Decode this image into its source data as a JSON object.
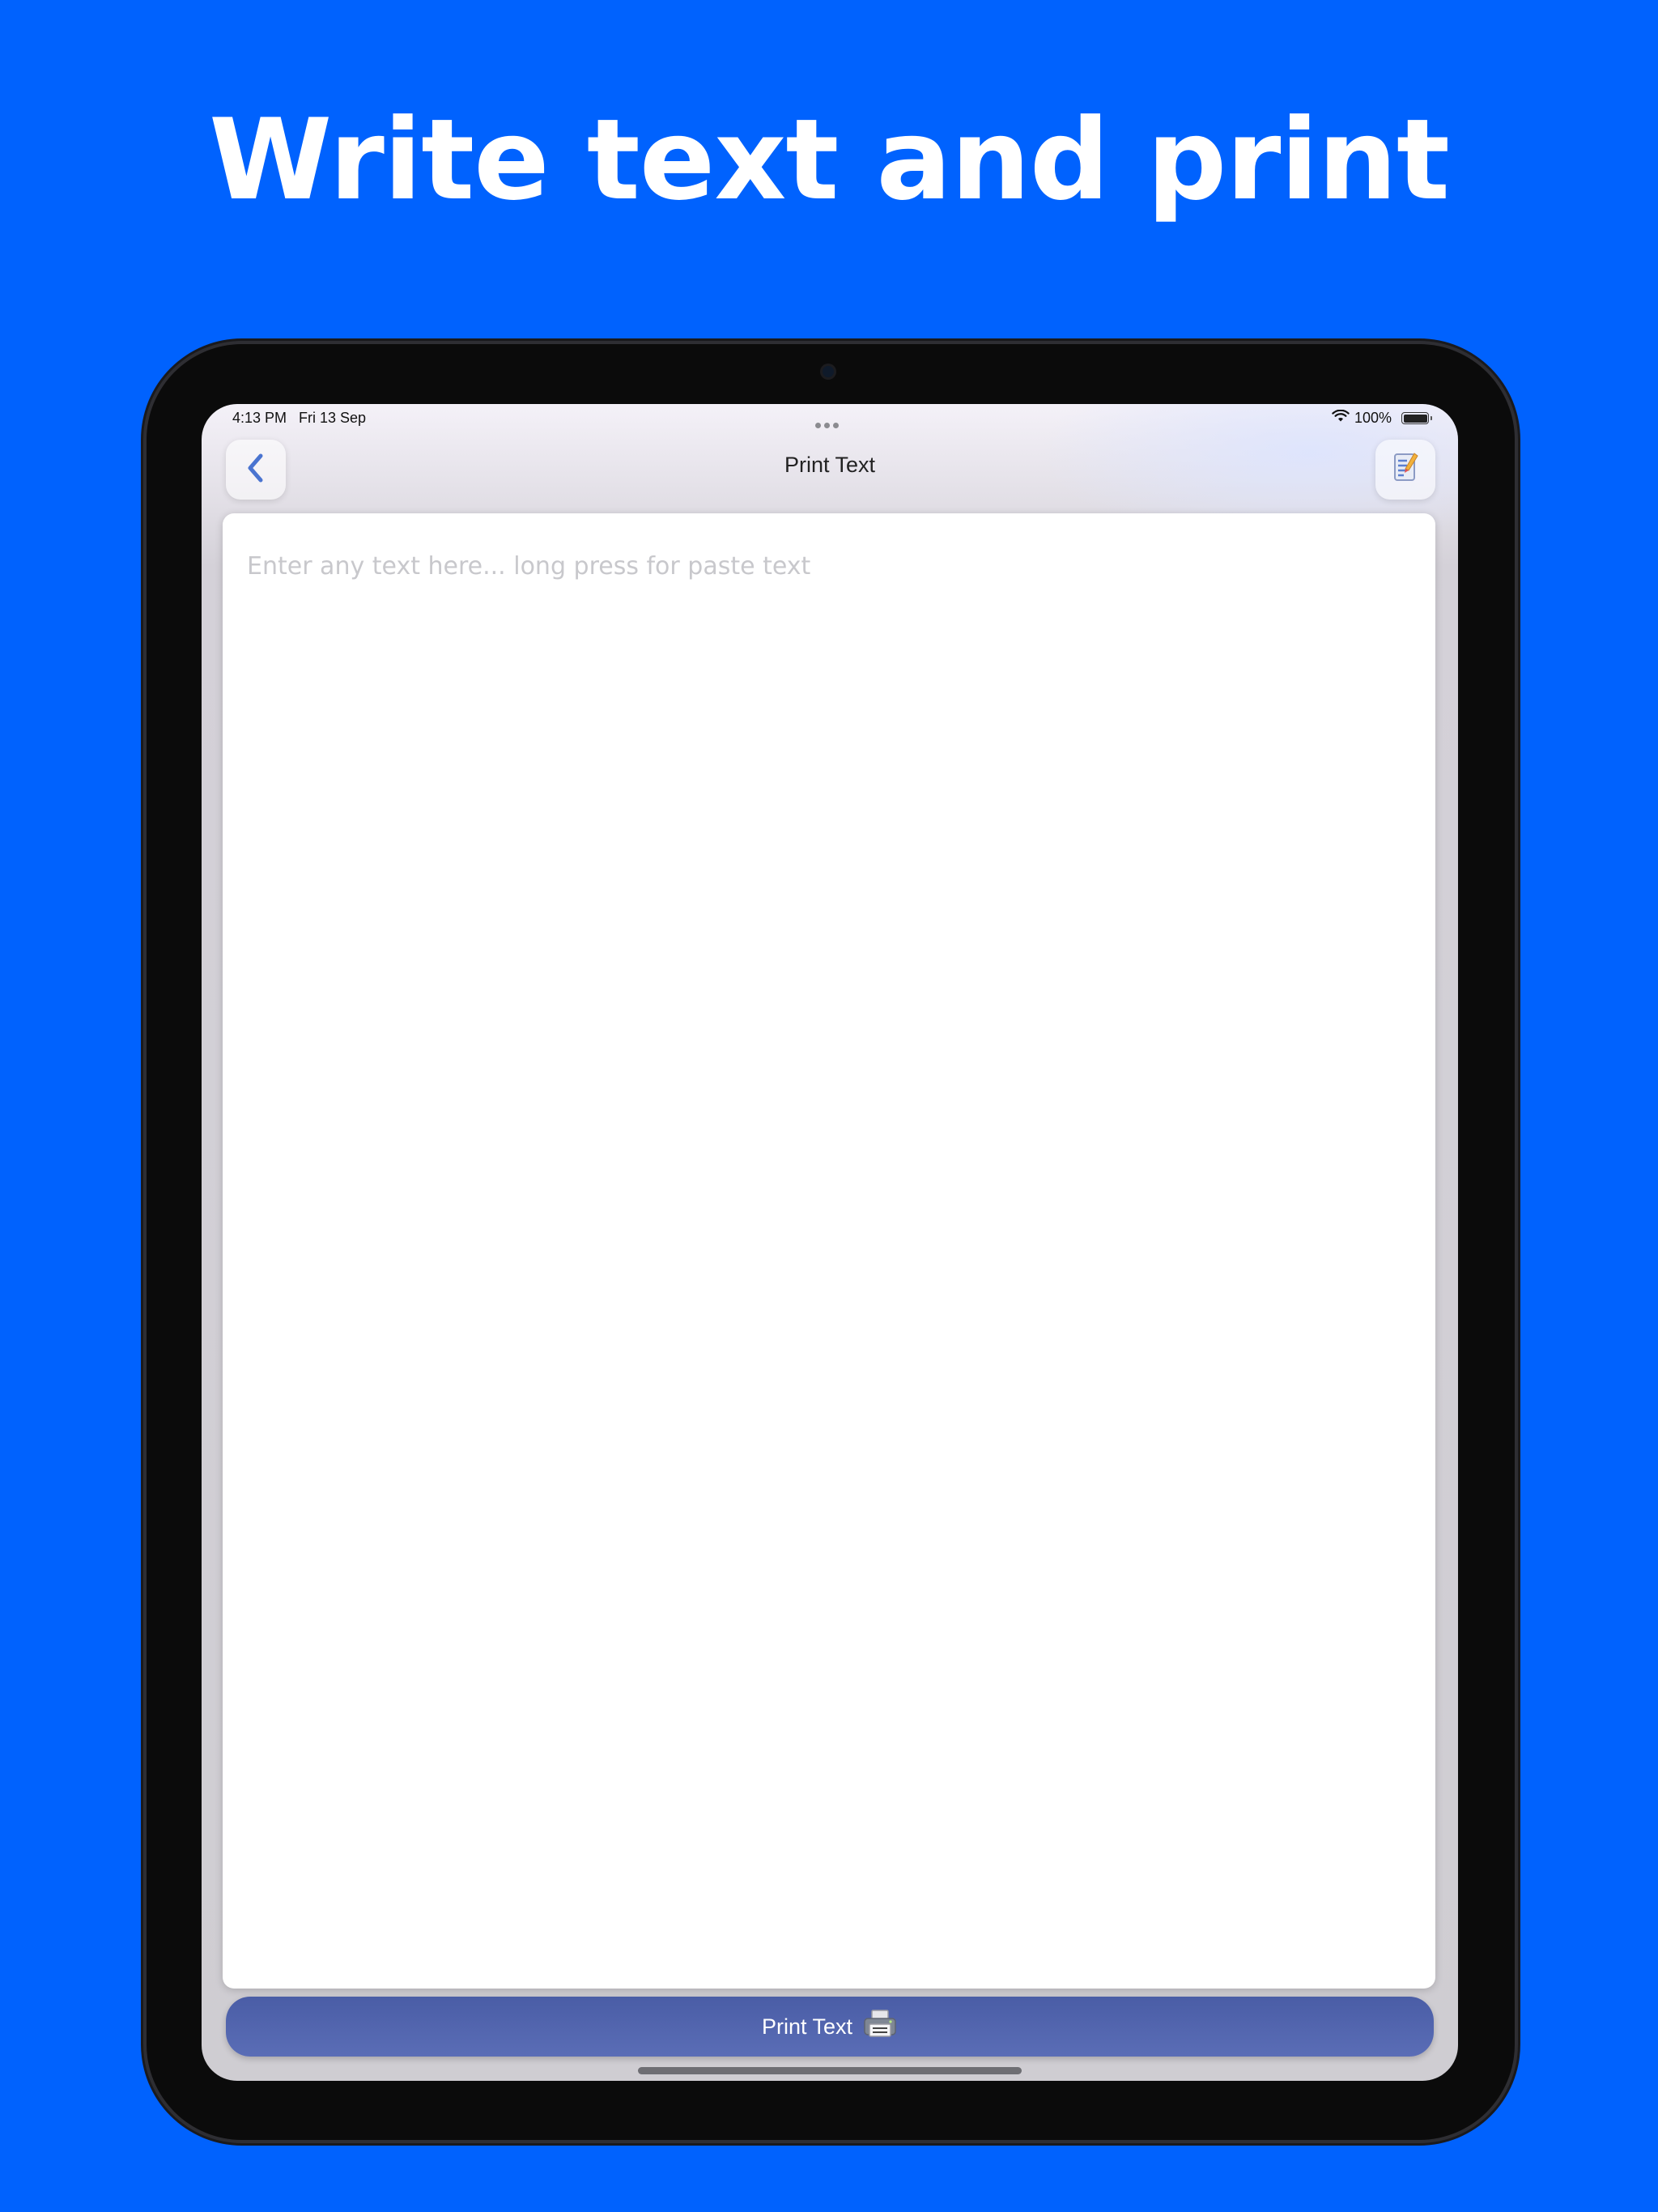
{
  "headline": "Write text and print",
  "status_bar": {
    "time": "4:13 PM",
    "date": "Fri 13 Sep",
    "battery": "100%"
  },
  "nav": {
    "title": "Print Text",
    "back_icon": "chevron-left-icon",
    "right_icon": "notes-pencil-icon"
  },
  "editor": {
    "placeholder": "Enter any text here... long press for paste text",
    "value": ""
  },
  "print_button": {
    "label": "Print Text",
    "icon": "printer-icon"
  },
  "colors": {
    "background": "#0062fe",
    "button": "#5165ad",
    "back_chevron": "#4a74d0"
  }
}
